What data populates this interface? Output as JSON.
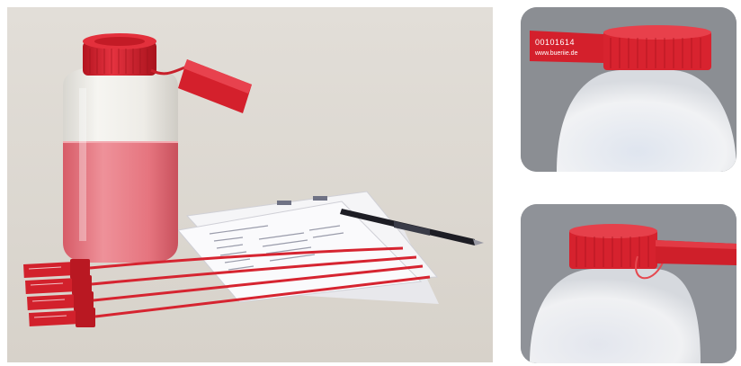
{
  "main_photo": {
    "description_icon": "sample-bottle-with-seals-photo",
    "colors": {
      "background": "#ddd9d2",
      "bottle": "#eeece6",
      "liquid": "#e46a75",
      "cap": "#d4202c",
      "paper": "#f4f4f6",
      "pen": "#1c1c22"
    }
  },
  "inset_top": {
    "seal_number": "00101614",
    "seal_url": "www.bueriie.de"
  },
  "inset_bottom": {
    "icon": "cap-with-seal-tag-photo"
  }
}
